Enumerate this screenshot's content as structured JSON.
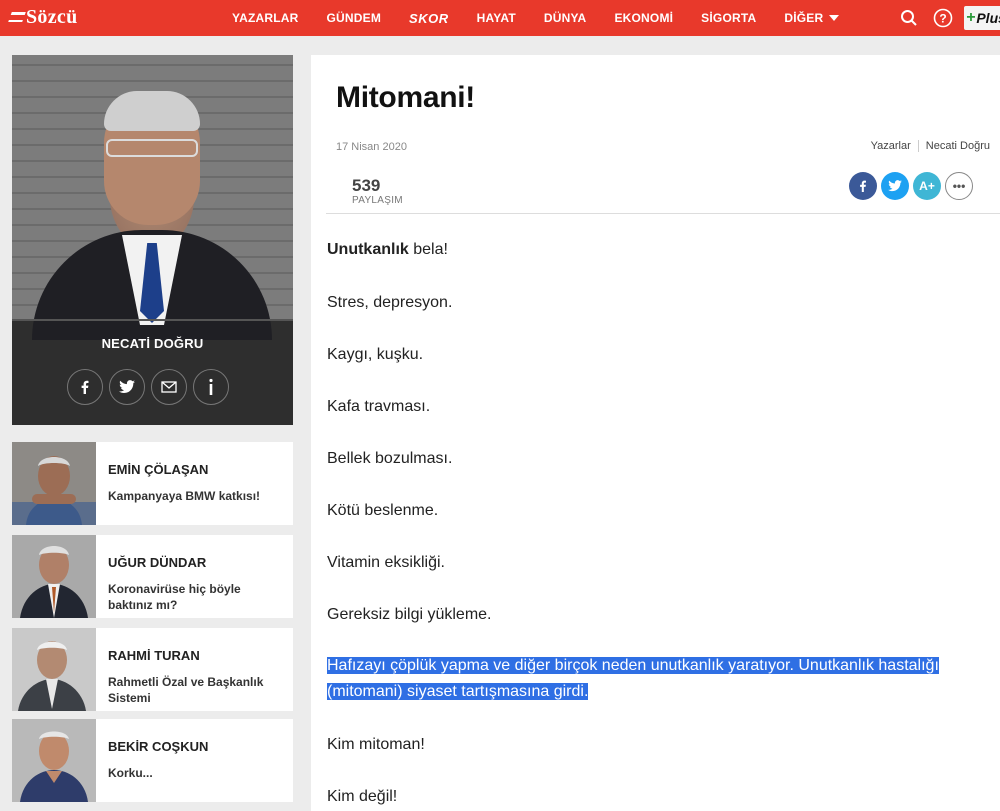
{
  "header": {
    "logo": "Sözcü",
    "nav": [
      {
        "label": "YAZARLAR"
      },
      {
        "label": "GÜNDEM"
      },
      {
        "label": "SKOR"
      },
      {
        "label": "HAYAT"
      },
      {
        "label": "DÜNYA"
      },
      {
        "label": "EKONOMİ"
      },
      {
        "label": "SİGORTA"
      },
      {
        "label": "DİĞER"
      }
    ],
    "plus_label": "Plus",
    "colors": {
      "brand": "#e8392b"
    }
  },
  "author": {
    "name": "NECATİ DOĞRU"
  },
  "writers": [
    {
      "name": "EMİN ÇÖLAŞAN",
      "title": "Kampanyaya BMW katkısı!"
    },
    {
      "name": "UĞUR DÜNDAR",
      "title": "Koronavirüse hiç böyle baktınız mı?"
    },
    {
      "name": "RAHMİ TURAN",
      "title": "Rahmetli Özal ve Başkanlık Sistemi"
    },
    {
      "name": "BEKİR COŞKUN",
      "title": "Korku..."
    }
  ],
  "article": {
    "title": "Mitomani!",
    "date": "17 Nisan 2020",
    "breadcrumb": [
      "Yazarlar",
      "Necati Doğru"
    ],
    "share_count": "539",
    "share_label": "PAYLAŞIM",
    "font_button": "A+",
    "more_button": "•••",
    "p1_bold": "Unutkanlık",
    "p1_rest": " bela!",
    "paragraphs": [
      "Stres, depresyon.",
      "Kaygı, kuşku.",
      "Kafa travması.",
      "Bellek bozulması.",
      "Kötü beslenme.",
      "Vitamin eksikliği.",
      "Gereksiz bilgi yükleme."
    ],
    "highlight_line1": "Hafızayı çöplük yapma ve diğer birçok neden unutkanlık yaratıyor. Unutkanlık hastalığı",
    "highlight_line2": "(mitomani) siyaset tartışmasına girdi.",
    "after": [
      "Kim mitoman!",
      "Kim değil!"
    ]
  }
}
